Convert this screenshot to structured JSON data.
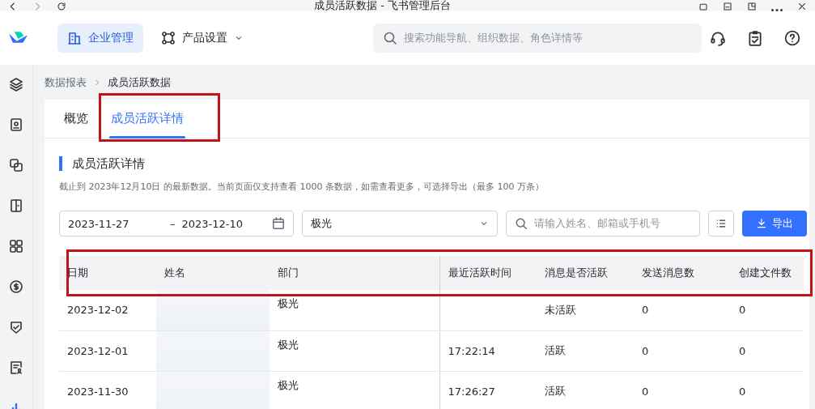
{
  "window": {
    "title": "成员活跃数据 - 飞书管理后台"
  },
  "header": {
    "nav": [
      {
        "label": "企业管理",
        "selected": true,
        "kind": "building"
      },
      {
        "label": "产品设置",
        "selected": false,
        "kind": "nodes"
      }
    ],
    "search": {
      "placeholder": "搜索功能导航、组织数据、角色详情等"
    }
  },
  "sidebar": {
    "items": [
      {
        "kind": "layers",
        "selected": false
      },
      {
        "kind": "contacts",
        "selected": false
      },
      {
        "kind": "link",
        "selected": false
      },
      {
        "kind": "door",
        "selected": false
      },
      {
        "kind": "grid",
        "selected": false
      },
      {
        "kind": "coin",
        "selected": false
      },
      {
        "kind": "shield",
        "selected": false
      },
      {
        "kind": "form",
        "selected": false
      },
      {
        "kind": "chart",
        "selected": true
      }
    ]
  },
  "breadcrumb": [
    "数据报表",
    "成员活跃数据"
  ],
  "tabs": [
    {
      "label": "概览",
      "selected": false
    },
    {
      "label": "成员活跃详情",
      "selected": true
    }
  ],
  "section": {
    "title": "成员活跃详情",
    "description": "截止到 2023年12月10日 的最新数据。当前页面仅支持查看 1000 条数据，如需查看更多，可选择导出（最多 100 万条）"
  },
  "filters": {
    "date_start": "2023-11-27",
    "date_separator": "–",
    "date_end": "2023-12-10",
    "department": "极光",
    "search": {
      "placeholder": "请输入姓名、邮箱或手机号"
    },
    "export_button": "导出"
  },
  "table": {
    "columns": [
      "日期",
      "姓名",
      "部门",
      "最近活跃时间",
      "消息是否活跃",
      "发送消息数",
      "创建文件数"
    ],
    "rows": [
      [
        "2023-12-02",
        "",
        "极光",
        "",
        "未活跃",
        "0",
        "0"
      ],
      [
        "2023-12-01",
        "",
        "极光",
        "17:22:14",
        "活跃",
        "0",
        "0"
      ],
      [
        "2023-11-30",
        "",
        "极光",
        "17:26:27",
        "活跃",
        "0",
        "0"
      ]
    ]
  }
}
